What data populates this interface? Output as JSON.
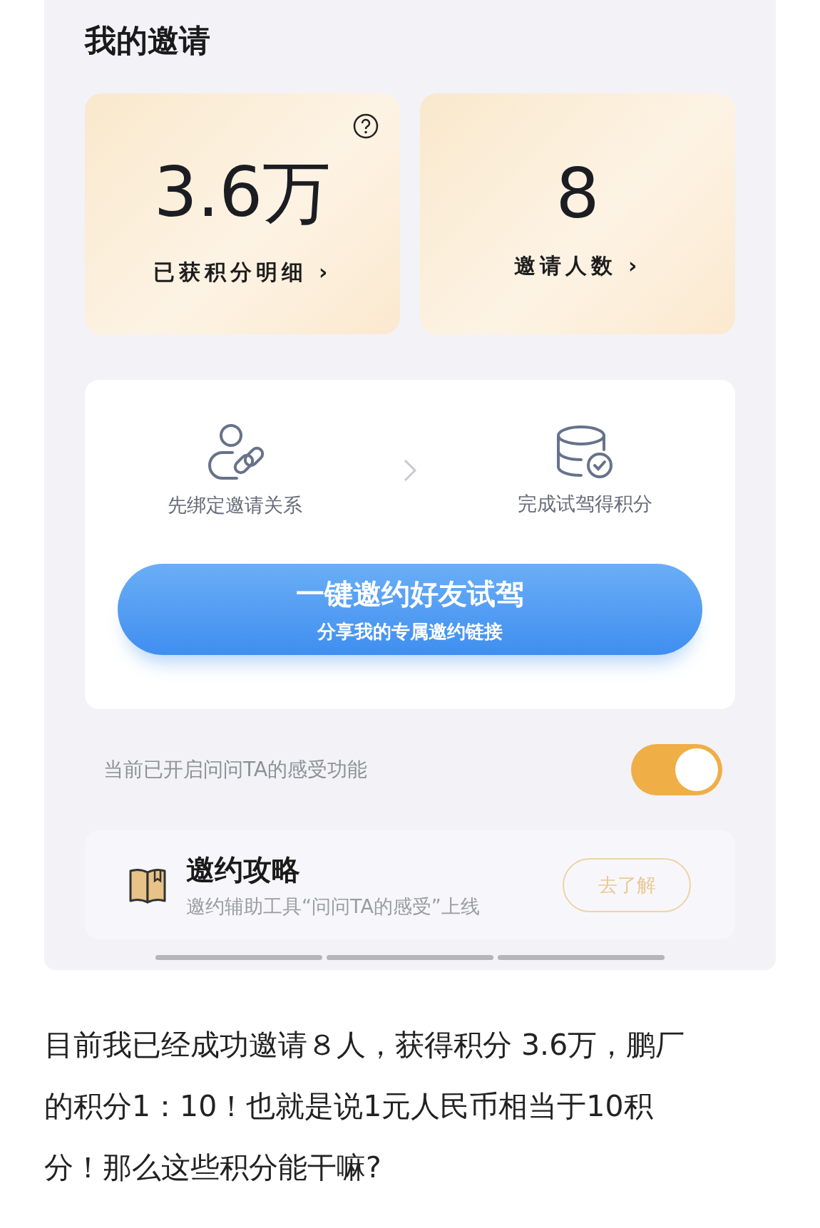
{
  "panel": {
    "title": "我的邀请",
    "stats": [
      {
        "value": "3.6万",
        "label": "已获积分明细",
        "chevron": "›",
        "help": true
      },
      {
        "value": "8",
        "label": "邀请人数",
        "chevron": "›",
        "help": false
      }
    ],
    "steps": [
      {
        "kind": "person-link",
        "label": "先绑定邀请关系"
      },
      {
        "kind": "database-check",
        "label": "完成试驾得积分"
      }
    ],
    "invite_button": {
      "title": "一键邀约好友试驾",
      "subtitle": "分享我的专属邀约链接"
    },
    "feature_toggle": {
      "label": "当前已开启问问TA的感受功能",
      "on": true
    },
    "guide": {
      "title": "邀约攻略",
      "subtitle": "邀约辅助工具“问问TA的感受”上线",
      "button": "去了解"
    }
  },
  "article_text": "目前我已经成功邀请８人，获得积分 3.6万，鹏厂的积分1：10！也就是说1元人民币相当于10积分！那么这些积分能干嘛?"
}
